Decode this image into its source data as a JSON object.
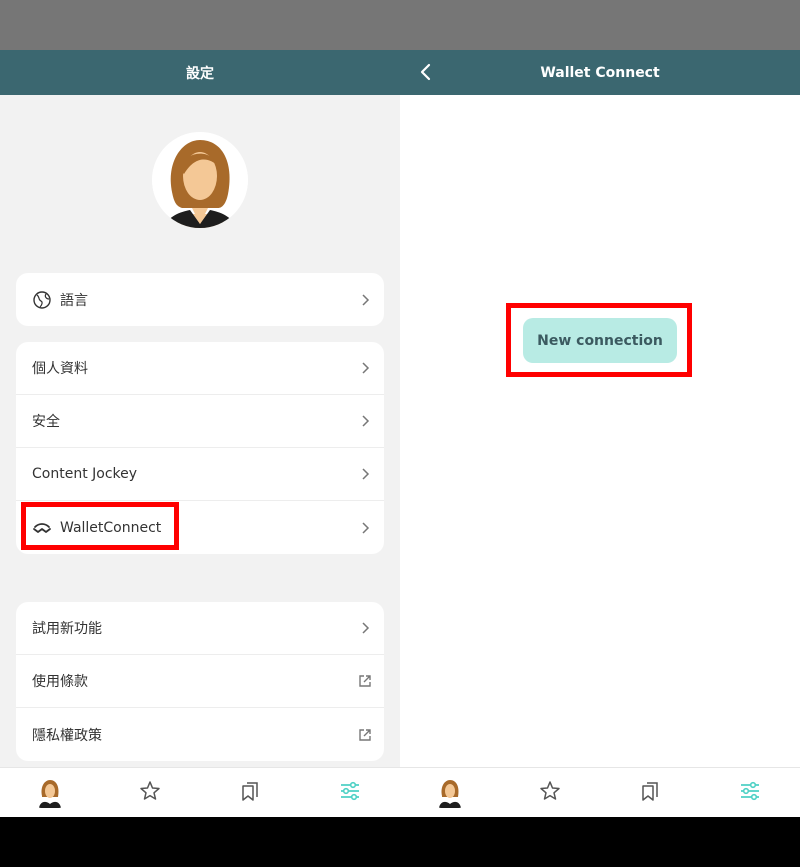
{
  "left": {
    "header_title": "設定",
    "card1": {
      "language": "語言"
    },
    "card2": {
      "items": [
        "個人資料",
        "安全",
        "Content Jockey",
        "WalletConnect"
      ]
    },
    "card3": {
      "items": [
        "試用新功能",
        "使用條款",
        "隱私權政策"
      ]
    }
  },
  "right": {
    "header_title": "Wallet Connect",
    "new_connection": "New connection"
  },
  "colors": {
    "header_bg": "#3b6770",
    "status_bar": "#767676",
    "accent_teal": "#4fd1c5",
    "button_bg": "#b8ebe4",
    "highlight": "#ff0000"
  },
  "icons": {
    "language": "globe-icon",
    "walletconnect": "walletconnect-icon",
    "chevron": "chevron-right-icon",
    "external": "external-link-icon",
    "nav": [
      "avatar",
      "star-icon",
      "bookmarks-icon",
      "sliders-icon"
    ]
  }
}
